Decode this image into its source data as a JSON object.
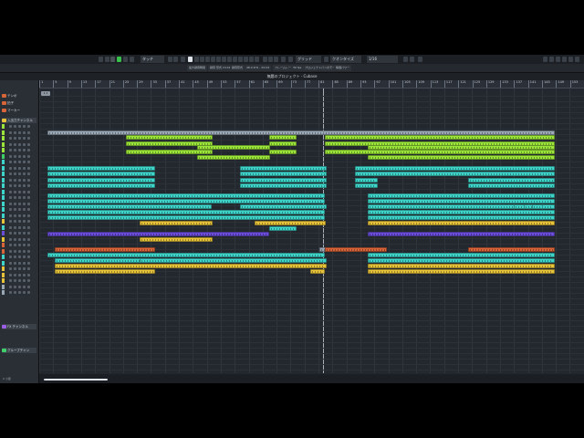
{
  "toolbar": {
    "mode_label": "タッチ",
    "grid_label": "グリッド",
    "quantize_label": "クオンタイズ",
    "quantize_value": "1/16"
  },
  "statusbar": [
    "最大録音時間",
    "録音 形式 24 bit",
    "録音形式",
    "48.0 kHz - 24 bit",
    "フレームレート",
    "30 fps",
    "プロジェクトパンのモード",
    "等価パワー"
  ],
  "project_title": "無題のプロジェクト - Cubase",
  "left_zone": {
    "tracks_header": "入出力チャンネル",
    "fx_header": "FX チャンネル",
    "group_header": "グループチャン",
    "rows": [
      "テンポ",
      "拍子",
      "マーカー"
    ]
  },
  "ruler": {
    "bars": [
      "1",
      "5",
      "9",
      "13",
      "17",
      "21",
      "25",
      "29",
      "33",
      "37",
      "41",
      "45",
      "49",
      "53",
      "57",
      "61",
      "65",
      "69",
      "73",
      "77",
      "81",
      "85",
      "89",
      "93",
      "97",
      "101",
      "105",
      "109",
      "113",
      "117",
      "121",
      "125",
      "129",
      "133",
      "137",
      "141",
      "145",
      "149",
      "153"
    ]
  },
  "locator_label": "1.1",
  "colors": {
    "teal": "#3fd4c9",
    "lime": "#9be53a",
    "yellow": "#e7c33a",
    "purple": "#6a4dd8",
    "orange": "#d8643a",
    "green": "#3fcf6a",
    "grey": "#9aa7b4"
  },
  "scroll_label": "0 小節"
}
